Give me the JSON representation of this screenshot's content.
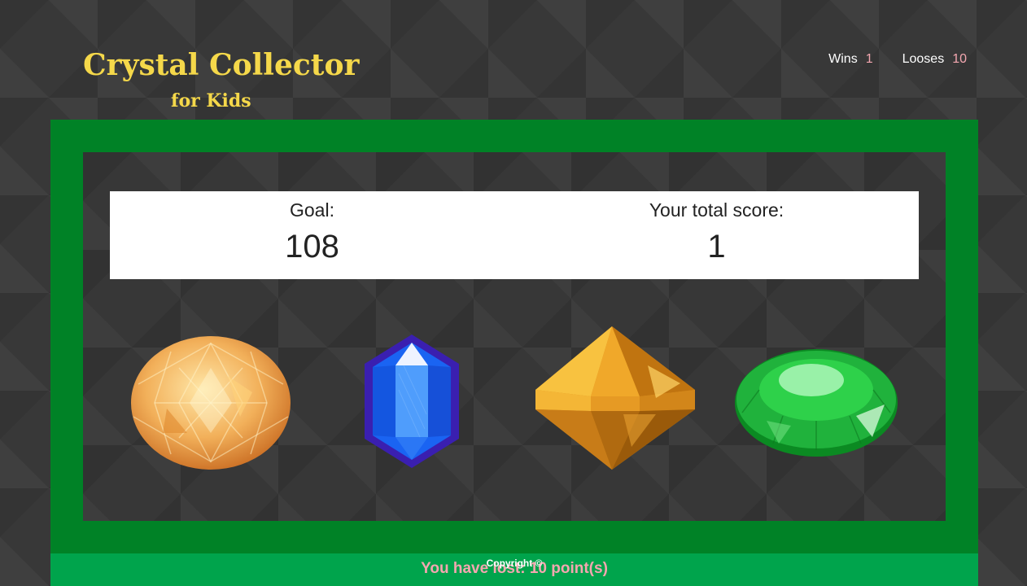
{
  "header": {
    "title": "Crystal Collector",
    "subtitle": "for Kids"
  },
  "stats": {
    "wins_label": "Wins",
    "wins_value": "1",
    "losses_label": "Looses",
    "losses_value": "10"
  },
  "score": {
    "goal_label": "Goal:",
    "goal_value": "108",
    "total_label": "Your total score:",
    "total_value": "1"
  },
  "crystals": [
    {
      "name": "orange-round-crystal",
      "color": "#f0a040"
    },
    {
      "name": "blue-hexagon-crystal",
      "color": "#1e5ef0"
    },
    {
      "name": "gold-diamond-crystal",
      "color": "#e8a424"
    },
    {
      "name": "green-oval-crystal",
      "color": "#1fb83a"
    }
  ],
  "footer": {
    "message": "You have lost: 10 point(s)",
    "copyright": "Copyright ©"
  },
  "colors": {
    "title": "#f5d84a",
    "frame": "#008226",
    "footer": "#00a44c",
    "accent_pink": "#f4a7b0"
  }
}
